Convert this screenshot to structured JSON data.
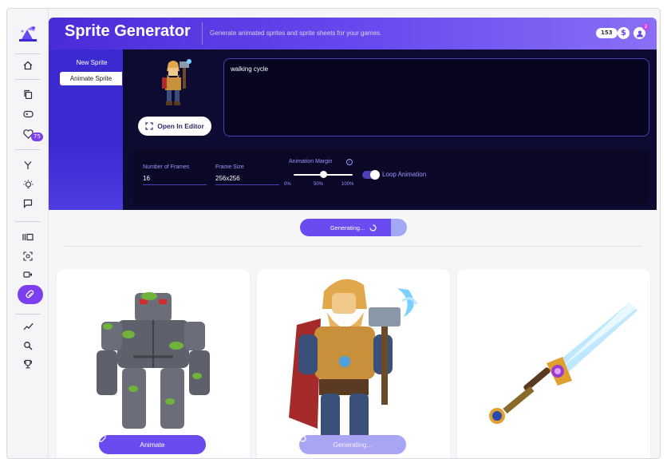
{
  "app": {
    "title": "Sprite Generator",
    "subtitle": "Generate animated sprites and sprite sheets for your games.",
    "credits": "153",
    "notification_count": "2"
  },
  "sidebar": {
    "items": [
      {
        "name": "home-icon"
      },
      {
        "name": "copy-icon"
      },
      {
        "name": "gamepad-icon"
      },
      {
        "name": "heart-icon",
        "badge": "75"
      },
      {
        "name": "fork-icon"
      },
      {
        "name": "bulb-icon"
      },
      {
        "name": "chat-icon"
      },
      {
        "name": "gallery-icon"
      },
      {
        "name": "scan-icon"
      },
      {
        "name": "video-icon"
      },
      {
        "name": "sprite-icon",
        "active": true
      },
      {
        "name": "sparkle-chart-icon"
      },
      {
        "name": "search-icon"
      },
      {
        "name": "trophy-icon"
      }
    ]
  },
  "modes": {
    "new_sprite": "New Sprite",
    "animate_sprite": "Animate Sprite"
  },
  "editor": {
    "open_label": "Open In Editor",
    "prompt_value": "walking cycle"
  },
  "settings": {
    "frames_label": "Number of Frames",
    "frames_value": "16",
    "size_label": "Frame Size",
    "size_value": "256x256",
    "margin_label": "Animation Margin",
    "margin_ticks": [
      "0%",
      "50%",
      "100%"
    ],
    "margin_value": 50,
    "loop_label": "Loop Animation",
    "loop_on": true
  },
  "main": {
    "generating_label": "Generating...",
    "cards": [
      {
        "name": "golem",
        "button": "Animate",
        "state": "ready"
      },
      {
        "name": "warrior",
        "button": "Generating...",
        "state": "generating"
      },
      {
        "name": "sword",
        "button": "",
        "state": "none"
      }
    ]
  },
  "colors": {
    "accent": "#6a4bf0",
    "panel": "#0e0b33",
    "header_start": "#4a2bd8",
    "header_end": "#8a6ff5"
  }
}
